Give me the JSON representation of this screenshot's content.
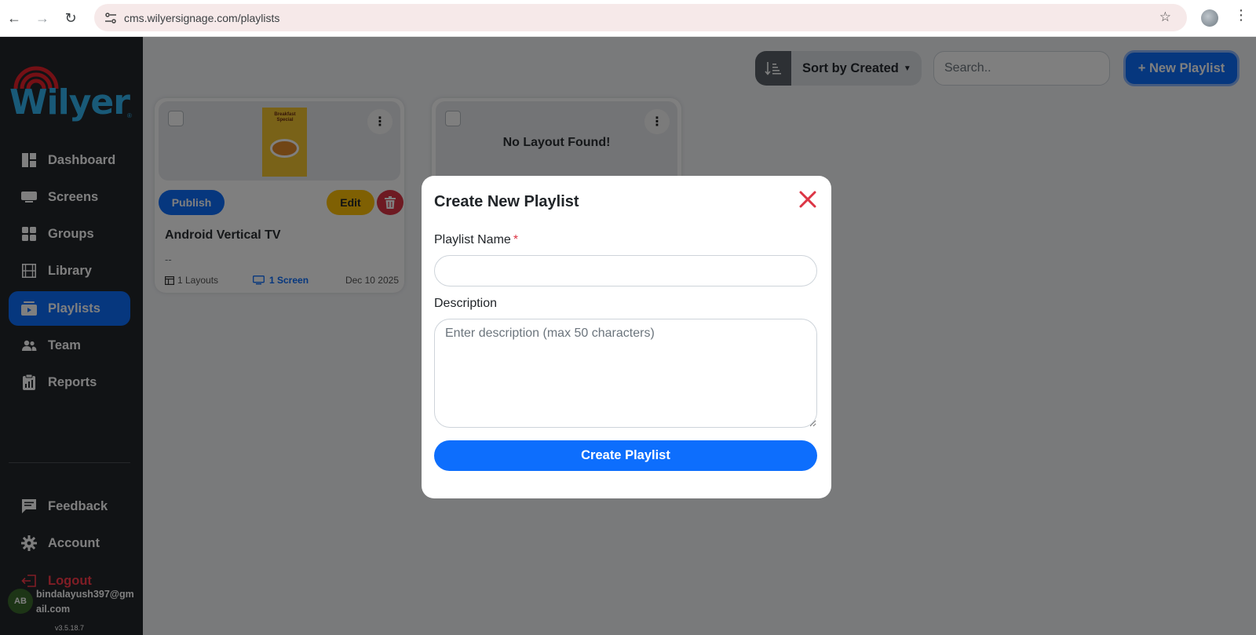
{
  "browser": {
    "url": "cms.wilyersignage.com/playlists"
  },
  "brand": {
    "name": "Wilyer",
    "reg": "®"
  },
  "sidebar": {
    "items": [
      {
        "label": "Dashboard",
        "icon": "dashboard-icon"
      },
      {
        "label": "Screens",
        "icon": "monitor-icon"
      },
      {
        "label": "Groups",
        "icon": "grid-icon"
      },
      {
        "label": "Library",
        "icon": "film-icon"
      },
      {
        "label": "Playlists",
        "icon": "playlist-icon",
        "active": true
      },
      {
        "label": "Team",
        "icon": "team-icon"
      },
      {
        "label": "Reports",
        "icon": "clipboard-icon"
      }
    ],
    "bottom_items": [
      {
        "label": "Feedback",
        "icon": "feedback-icon"
      },
      {
        "label": "Account",
        "icon": "gear-icon"
      },
      {
        "label": "Logout",
        "icon": "logout-icon"
      }
    ],
    "user": {
      "initials": "AB",
      "email": "bindalayush397@gmail.com"
    },
    "version": "v3.5.18.7"
  },
  "toolbar": {
    "sort_label": "Sort by Created",
    "search_placeholder": "Search..",
    "new_playlist_label": "+ New Playlist"
  },
  "cards": [
    {
      "title": "Android Vertical TV",
      "description": "--",
      "layouts": "1 Layouts",
      "screens": "1 Screen",
      "date": "Dec 10 2025",
      "publish_label": "Publish",
      "edit_label": "Edit",
      "poster_text": "Breakfast Special"
    },
    {
      "empty_text": "No Layout Found!"
    }
  ],
  "modal": {
    "title": "Create New Playlist",
    "name_label": "Playlist Name",
    "required_mark": "*",
    "name_value": "",
    "description_label": "Description",
    "description_placeholder": "Enter description (max 50 characters)",
    "submit_label": "Create Playlist"
  },
  "colors": {
    "primary": "#0d6efd",
    "sidebar_bg": "#22262b",
    "brand_blue": "#33b5f0",
    "brand_red": "#e8202a",
    "edit_yellow": "#ffc107",
    "danger": "#dc3545"
  }
}
